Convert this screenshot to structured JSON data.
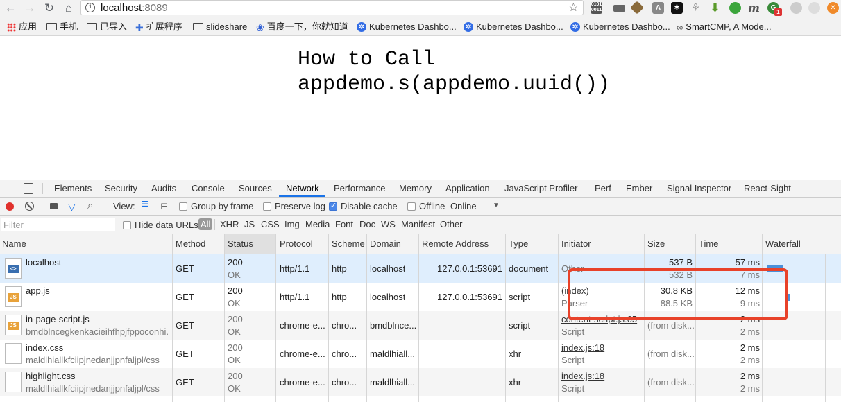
{
  "browser": {
    "url_host": "localhost",
    "url_port": ":8089",
    "bookmarks": [
      {
        "label": "应用",
        "icon": "apps-grid-icon"
      },
      {
        "label": "手机",
        "icon": "folder-icon"
      },
      {
        "label": "已导入",
        "icon": "folder-icon"
      },
      {
        "label": "扩展程序",
        "icon": "puzzle-icon"
      },
      {
        "label": "slideshare",
        "icon": "folder-icon"
      },
      {
        "label": "百度一下，你就知道",
        "icon": "baidu-paw-icon"
      },
      {
        "label": "Kubernetes Dashbo...",
        "icon": "kubernetes-icon"
      },
      {
        "label": "Kubernetes Dashbo...",
        "icon": "kubernetes-icon"
      },
      {
        "label": "Kubernetes Dashbo...",
        "icon": "kubernetes-icon"
      },
      {
        "label": "SmartCMP, A Mode...",
        "icon": "smartcmp-icon"
      }
    ],
    "ext_badge": "1"
  },
  "page": {
    "title_line1": "How to Call",
    "title_line2": "appdemo.s(appdemo.uuid())"
  },
  "devtools": {
    "tabs": [
      "Elements",
      "Security",
      "Audits",
      "Console",
      "Sources",
      "Network",
      "Performance",
      "Memory",
      "Application",
      "JavaScript Profiler",
      "Perf",
      "Ember",
      "Signal Inspector",
      "React-Sight"
    ],
    "active_tab": "Network",
    "controls": {
      "view_label": "View:",
      "group_by_frame": "Group by frame",
      "preserve_log": "Preserve log",
      "disable_cache": "Disable cache",
      "offline": "Offline",
      "throttle": "Online"
    },
    "filter": {
      "placeholder": "Filter",
      "hide_data_urls": "Hide data URLs",
      "types": [
        "All",
        "XHR",
        "JS",
        "CSS",
        "Img",
        "Media",
        "Font",
        "Doc",
        "WS",
        "Manifest",
        "Other"
      ]
    },
    "columns": [
      "Name",
      "Method",
      "Status",
      "Protocol",
      "Scheme",
      "Domain",
      "Remote Address",
      "Type",
      "Initiator",
      "Size",
      "Time",
      "Waterfall"
    ],
    "rows": [
      {
        "name": "localhost",
        "path": "",
        "icon": "html",
        "method": "GET",
        "status": "200",
        "status_text": "OK",
        "protocol": "http/1.1",
        "scheme": "http",
        "domain": "localhost",
        "remote": "127.0.0.1:53691",
        "type": "document",
        "initiator": "Other",
        "initiator2": "",
        "size": "537 B",
        "size2": "532 B",
        "time": "57 ms",
        "time2": "7 ms"
      },
      {
        "name": "app.js",
        "path": "",
        "icon": "js",
        "method": "GET",
        "status": "200",
        "status_text": "OK",
        "protocol": "http/1.1",
        "scheme": "http",
        "domain": "localhost",
        "remote": "127.0.0.1:53691",
        "type": "script",
        "initiator": "(index)",
        "initiator2": "Parser",
        "size": "30.8 KB",
        "size2": "88.5 KB",
        "time": "12 ms",
        "time2": "9 ms"
      },
      {
        "name": "in-page-script.js",
        "path": "bmdblncegkenkacieihfhpjfppoconhi...",
        "icon": "js",
        "method": "GET",
        "status": "200",
        "status_text": "OK",
        "protocol": "chrome-e...",
        "scheme": "chro...",
        "domain": "bmdblnce...",
        "remote": "",
        "type": "script",
        "initiator": "content-script.js:65",
        "initiator2": "Script",
        "size": "(from disk...",
        "size2": "",
        "time": "2 ms",
        "time2": "2 ms"
      },
      {
        "name": "index.css",
        "path": "maldlhiallkfciipjnedanjjpnfaljpl/css",
        "icon": "blank",
        "method": "GET",
        "status": "200",
        "status_text": "OK",
        "protocol": "chrome-e...",
        "scheme": "chro...",
        "domain": "maldlhiall...",
        "remote": "",
        "type": "xhr",
        "initiator": "index.js:18",
        "initiator2": "Script",
        "size": "(from disk...",
        "size2": "",
        "time": "2 ms",
        "time2": "2 ms"
      },
      {
        "name": "highlight.css",
        "path": "maldlhiallkfciipjnedanjjpnfaljpl/css",
        "icon": "blank",
        "method": "GET",
        "status": "200",
        "status_text": "OK",
        "protocol": "chrome-e...",
        "scheme": "chro...",
        "domain": "maldlhiall...",
        "remote": "",
        "type": "xhr",
        "initiator": "index.js:18",
        "initiator2": "Script",
        "size": "(from disk...",
        "size2": "",
        "time": "2 ms",
        "time2": "2 ms"
      }
    ]
  },
  "colors": {
    "record": "#e0312c",
    "accent": "#1a73e8",
    "annotation": "#e8422a",
    "waterfall": "#4a90d9"
  }
}
